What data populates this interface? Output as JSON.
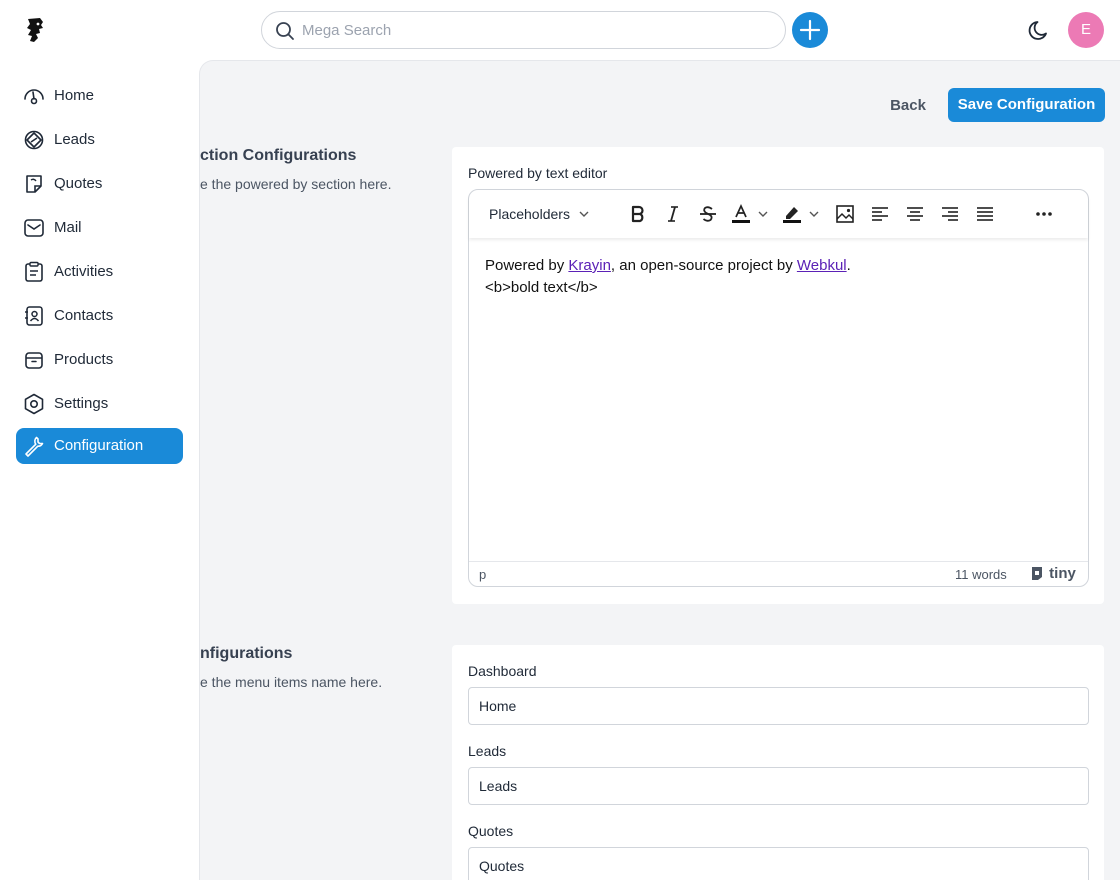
{
  "header": {
    "search_placeholder": "Mega Search",
    "avatar_initial": "E"
  },
  "sidebar": {
    "items": [
      {
        "label": "Home",
        "icon": "dashboard-icon"
      },
      {
        "label": "Leads",
        "icon": "leads-icon"
      },
      {
        "label": "Quotes",
        "icon": "quotes-icon"
      },
      {
        "label": "Mail",
        "icon": "mail-icon"
      },
      {
        "label": "Activities",
        "icon": "activities-icon"
      },
      {
        "label": "Contacts",
        "icon": "contacts-icon"
      },
      {
        "label": "Products",
        "icon": "products-icon"
      },
      {
        "label": "Settings",
        "icon": "settings-icon"
      },
      {
        "label": "Configuration",
        "icon": "wrench-icon",
        "active": true
      }
    ]
  },
  "actions": {
    "back_label": "Back",
    "save_label": "Save Configuration"
  },
  "powered_by": {
    "title": "ction Configurations",
    "description": "e the powered by section here.",
    "field_label": "Powered by text editor",
    "toolbar_select": "Placeholders",
    "content_line1_pre": "Powered by ",
    "content_link1": "Krayin",
    "content_line1_mid": ", an open-source project by ",
    "content_link2": "Webkul",
    "content_line1_post": ".",
    "content_line2": "<b>bold text</b>",
    "status_path": "p",
    "word_count": "11 words",
    "brand": "tiny"
  },
  "menu": {
    "title": "nfigurations",
    "description": "e the menu items name here.",
    "fields": [
      {
        "label": "Dashboard",
        "value": "Home"
      },
      {
        "label": "Leads",
        "value": "Leads"
      },
      {
        "label": "Quotes",
        "value": "Quotes"
      }
    ]
  },
  "colors": {
    "accent": "#1a8ad8",
    "avatar": "#ec7ab5",
    "content_bg": "#f3f4f6"
  }
}
